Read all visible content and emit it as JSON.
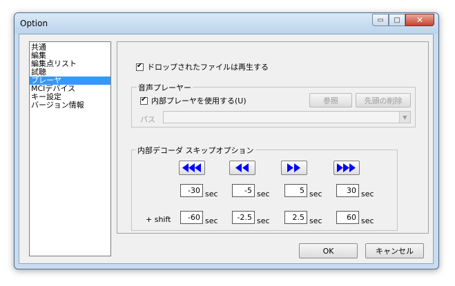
{
  "window": {
    "title": "Option"
  },
  "titlebar_buttons": {
    "minimize": "▭",
    "maximize": "□",
    "close": "✕"
  },
  "nav": {
    "items": [
      "共通",
      "編集",
      "編集点リスト",
      "試聴",
      "プレーヤ",
      "MCIデバイス",
      "キー設定",
      "バージョン情報"
    ],
    "selected": "プレーヤ"
  },
  "player": {
    "play_dropped_label": "ドロップされたファイルは再生する",
    "play_dropped_checked": true,
    "audio_player": {
      "group_label": "音声プレーヤー",
      "use_internal_label": "内部プレーヤを使用する(U)",
      "use_internal_checked": true,
      "browse_label": "参照",
      "remove_leading_label": "先頭の削除",
      "path_label": "パス",
      "path_value": ""
    },
    "skip": {
      "group_label": "内部デコーダ スキップオプション",
      "buttons": [
        "fast-rewind-icon",
        "rewind-icon",
        "forward-icon",
        "fast-forward-icon"
      ],
      "unit": "sec",
      "shift_label": "+ shift",
      "normal": [
        "-30",
        "-5",
        "5",
        "30"
      ],
      "shift": [
        "-60",
        "-2.5",
        "2.5",
        "60"
      ]
    }
  },
  "footer": {
    "ok_label": "OK",
    "cancel_label": "キャンセル"
  },
  "colors": {
    "accent": "#0000ff",
    "selection": "#3399ff",
    "close": "#c8432d"
  }
}
